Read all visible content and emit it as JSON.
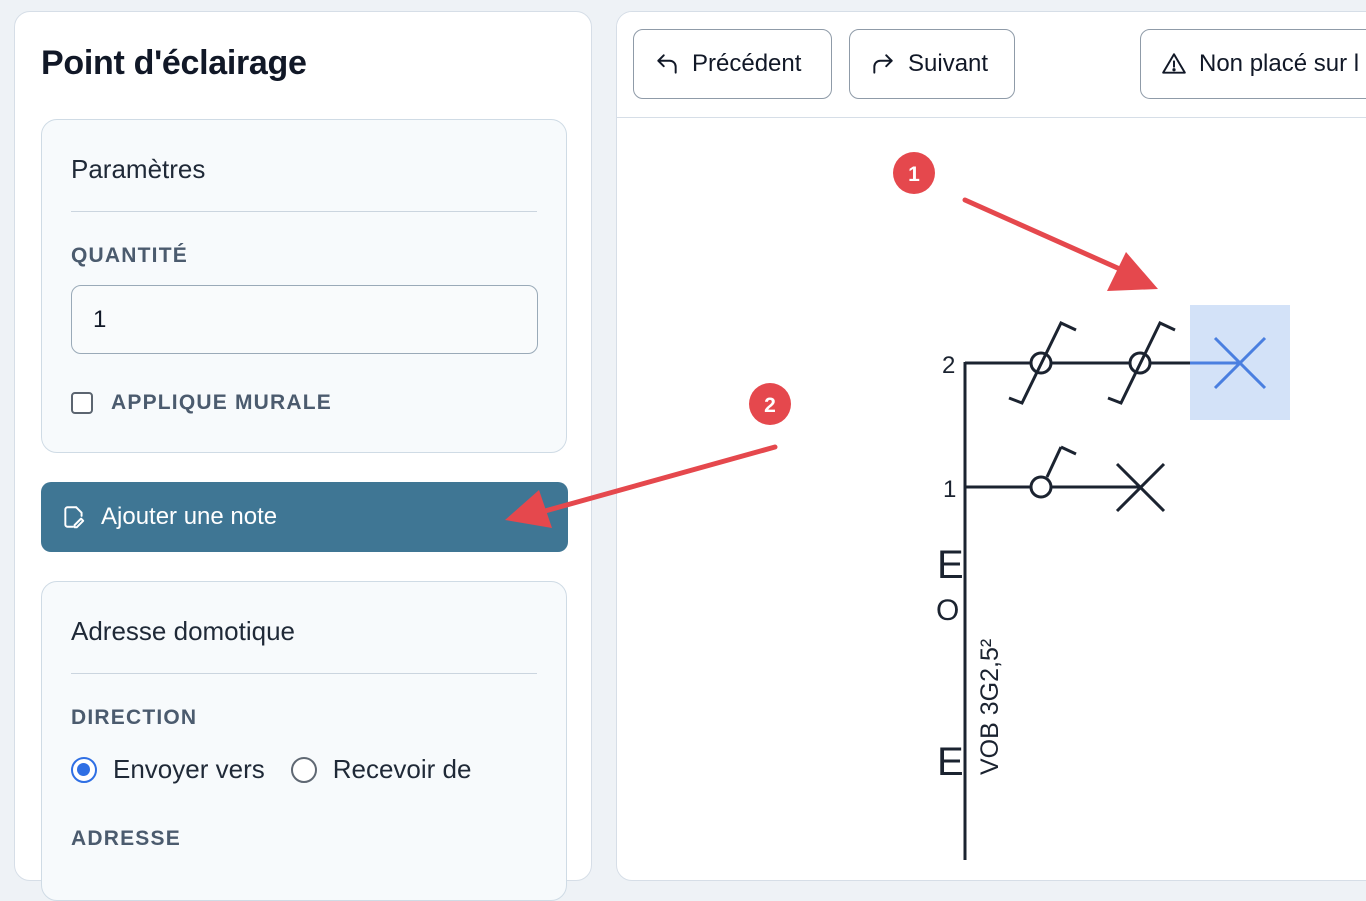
{
  "sidebar": {
    "title": "Point d'éclairage",
    "params": {
      "header": "Paramètres",
      "quantity_label": "QUANTITÉ",
      "quantity_value": "1",
      "wall_mount_label": "APPLIQUE MURALE",
      "wall_mount_checked": false
    },
    "add_note_label": "Ajouter une note",
    "domotic": {
      "header": "Adresse domotique",
      "direction_label": "DIRECTION",
      "direction_options": [
        "Envoyer vers",
        "Recevoir de"
      ],
      "direction_selected": "Envoyer vers",
      "address_label": "ADRESSE"
    }
  },
  "toolbar": {
    "previous_label": "Précédent",
    "next_label": "Suivant",
    "unplaced_label": "Non placé sur l"
  },
  "schematic": {
    "circuit_labels": [
      "2",
      "1"
    ],
    "cable_label": "VOB 3G2,5²",
    "symbol_letters": [
      "E",
      "O",
      "E"
    ]
  },
  "annotations": [
    "1",
    "2"
  ],
  "colors": {
    "accent_button": "#3f7694",
    "radio_selected": "#2f6fe4",
    "selected_symbol": "#4a7fe0",
    "selection_bg": "#d3e2f8",
    "marker_red": "#e5484d"
  }
}
